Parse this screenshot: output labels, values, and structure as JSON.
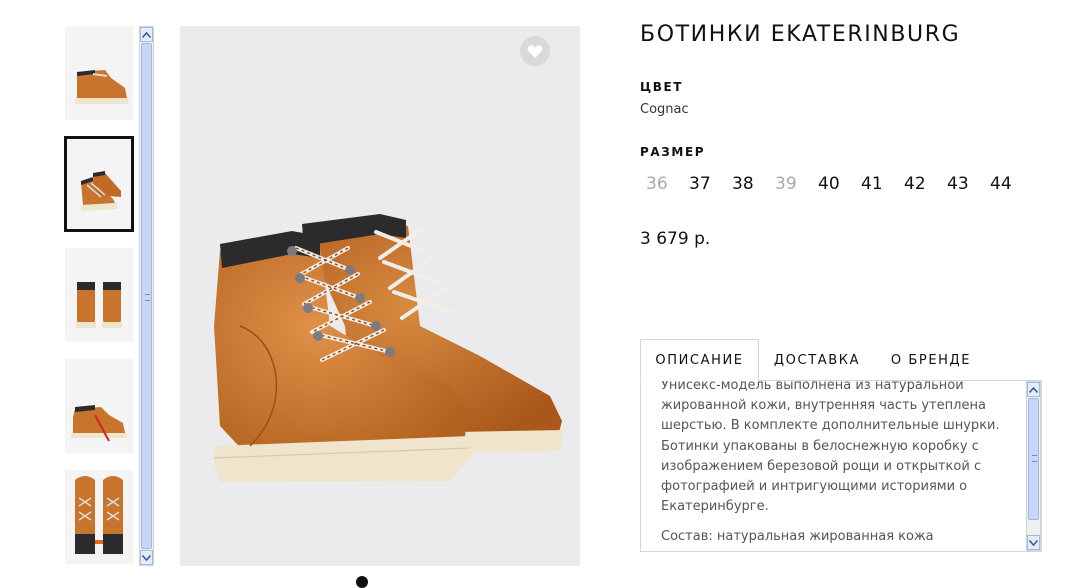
{
  "product": {
    "title": "БОТИНКИ EKATERINBURG",
    "color_label": "ЦВЕТ",
    "color_value": "Cognac",
    "size_label": "РАЗМЕР",
    "sizes": [
      {
        "value": "36",
        "available": false
      },
      {
        "value": "37",
        "available": true
      },
      {
        "value": "38",
        "available": true
      },
      {
        "value": "39",
        "available": false
      },
      {
        "value": "40",
        "available": true
      },
      {
        "value": "41",
        "available": true
      },
      {
        "value": "42",
        "available": true
      },
      {
        "value": "43",
        "available": true
      },
      {
        "value": "44",
        "available": true
      }
    ],
    "price": "3 679 р."
  },
  "tabs": [
    {
      "label": "ОПИСАНИЕ",
      "active": true
    },
    {
      "label": "ДОСТАВКА",
      "active": false
    },
    {
      "label": "О БРЕНДЕ",
      "active": false
    }
  ],
  "description": {
    "lines": [
      "Унисекс-модель выполнена из натуральной",
      "жированной кожи, внутренняя часть утеплена",
      "шерстью. В комплекте дополнительные шнурки.",
      "Ботинки упакованы в белоснежную коробку с",
      "изображением березовой рощи и открыткой с",
      "фотографией и интригующими историями о",
      "Екатеринбурге."
    ],
    "composition": "Состав: натуральная жированная кожа"
  },
  "gallery": {
    "thumbnail_views": [
      "side-view",
      "pair-three-quarter-view",
      "back-view",
      "side-view-laces",
      "top-view"
    ],
    "selected_index": 1
  },
  "icons": {
    "favorite": "heart-icon",
    "scroll_up": "chevron-up-icon",
    "scroll_down": "chevron-down-icon"
  },
  "colors": {
    "leather": "#c8742c",
    "sole": "#efe4cc",
    "collar": "#2b2b2d",
    "selected_border": "#111111",
    "scrollbar_thumb": "#c5d6f6"
  }
}
